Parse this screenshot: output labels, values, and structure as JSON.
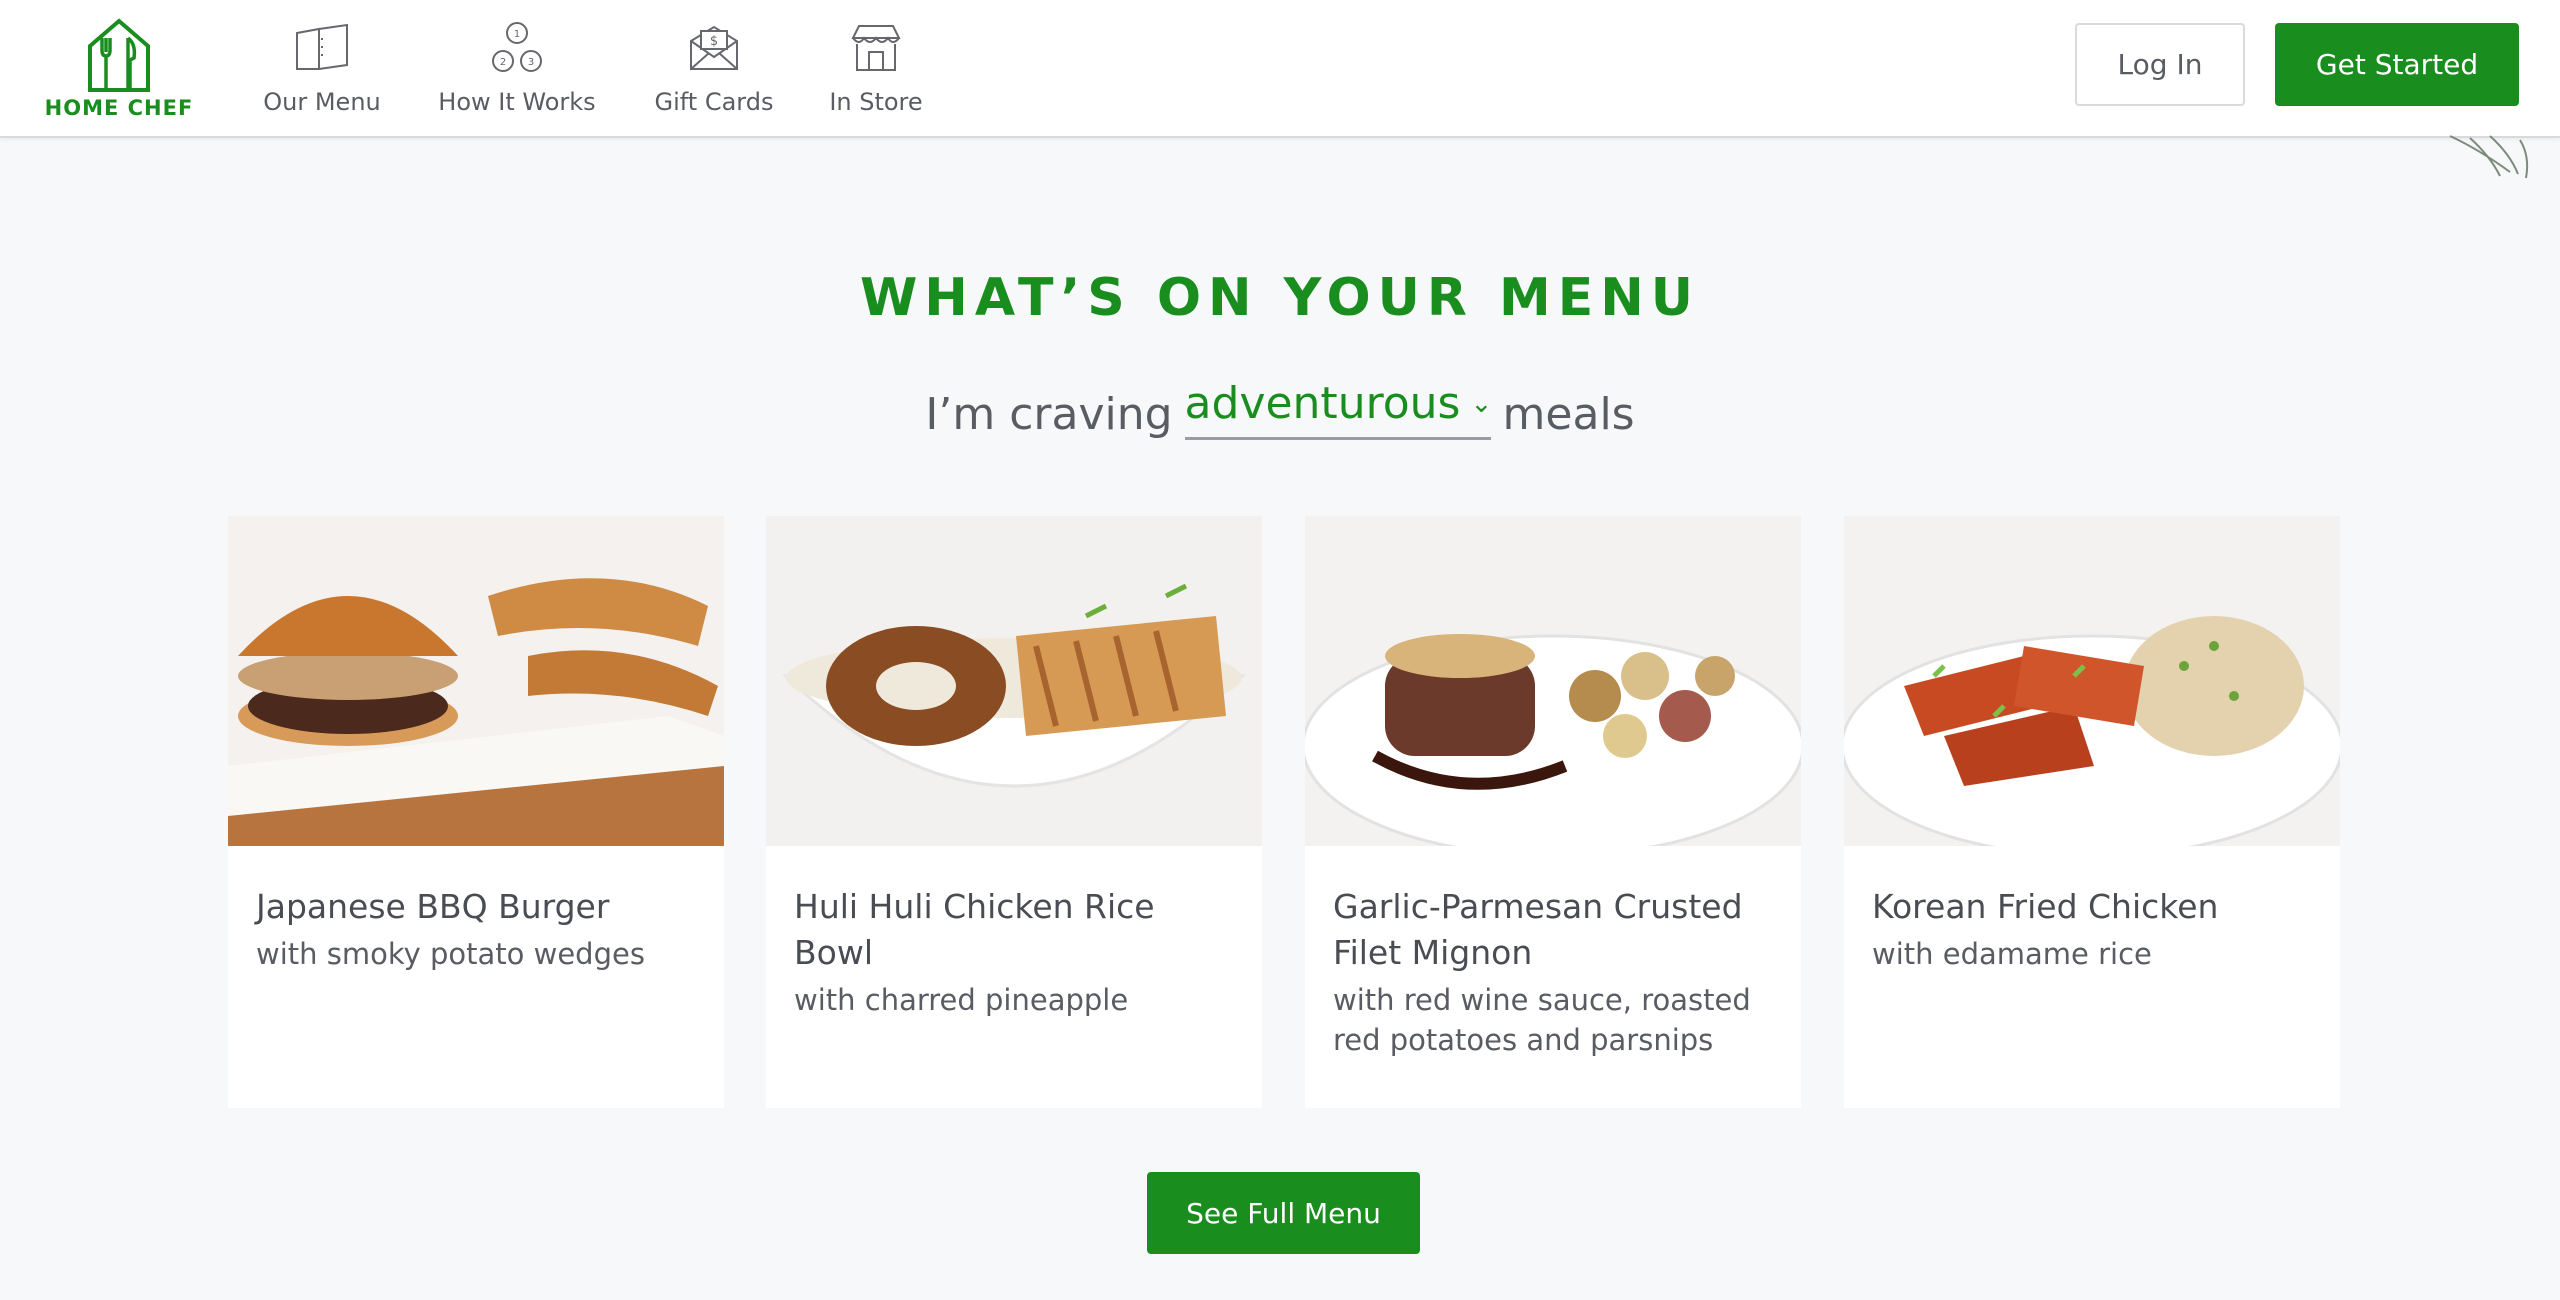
{
  "brand": {
    "name": "HOME CHEF",
    "icon": "chef-house-logo",
    "color": "#198d1e"
  },
  "nav": {
    "items": [
      {
        "label": "Our Menu",
        "icon": "menu-book-icon"
      },
      {
        "label": "How It Works",
        "icon": "steps-123-icon"
      },
      {
        "label": "Gift Cards",
        "icon": "gift-envelope-icon"
      },
      {
        "label": "In Store",
        "icon": "storefront-icon"
      }
    ],
    "login_label": "Log In",
    "start_label": "Get Started"
  },
  "hero": {
    "heading": "WHAT’S ON YOUR MENU",
    "craving_prefix": "I’m craving",
    "craving_value": "adventurous",
    "craving_suffix": "meals"
  },
  "cards": [
    {
      "title": "Japanese BBQ Burger",
      "subtitle": "with smoky potato wedges"
    },
    {
      "title": "Huli Huli Chicken Rice Bowl",
      "subtitle": "with charred pineapple"
    },
    {
      "title": "Garlic-Parmesan Crusted Filet Mignon",
      "subtitle": "with red wine sauce, roasted red potatoes and parsnips"
    },
    {
      "title": "Korean Fried Chicken",
      "subtitle": "with edamame rice"
    }
  ],
  "cta": {
    "full_menu_label": "See Full Menu"
  },
  "colors": {
    "accent": "#198d1e",
    "background": "#f7f8fa",
    "text": "#505259"
  }
}
